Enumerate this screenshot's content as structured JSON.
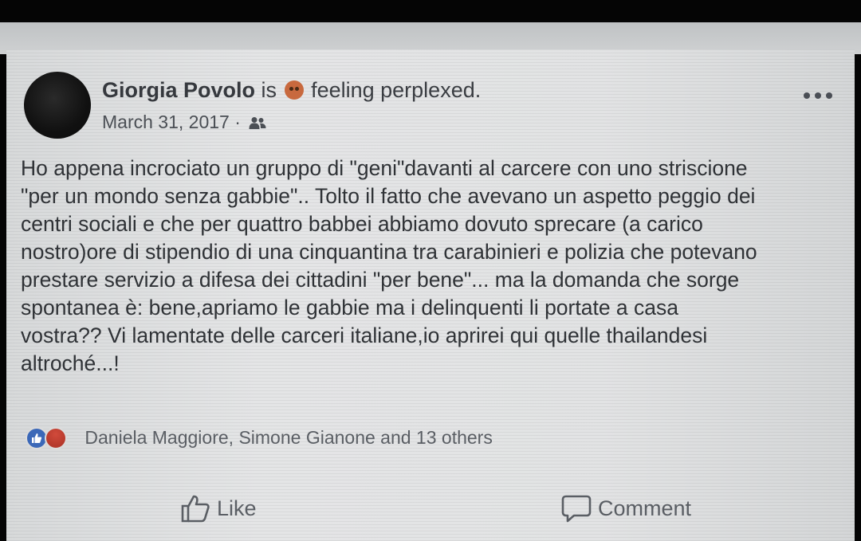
{
  "post": {
    "author": "Giorgia Povolo",
    "is_text": "is",
    "feeling_text": "feeling perplexed.",
    "date": "March 31, 2017",
    "date_separator": "·",
    "audience_icon": "friends-icon",
    "lines": [
      "Ho appena incrociato un gruppo di \"geni\"davanti al carcere con uno striscione",
      "\"per un mondo senza gabbie\".. Tolto il fatto che avevano un aspetto peggio dei",
      "centri sociali e che per quattro babbei abbiamo dovuto sprecare (a carico",
      "nostro)ore di stipendio di una cinquantina tra carabinieri e polizia che potevano",
      "prestare servizio a difesa dei cittadini \"per bene\"... ma la domanda che sorge",
      "spontanea è: bene,apriamo le gabbie ma i delinquenti li portate a casa",
      "vostra?? Vi lamentate delle carceri italiane,io aprirei qui quelle thailandesi",
      "altroché...!"
    ]
  },
  "reactions": {
    "summary": "Daniela Maggiore, Simone Gianone and 13 others",
    "icons": [
      "like-icon",
      "angry-icon"
    ]
  },
  "actions": {
    "like_label": "Like",
    "comment_label": "Comment"
  },
  "colors": {
    "like_reaction": "#3b68b8",
    "angry_reaction": "#b5392c",
    "card_background": "#dfe1e2"
  }
}
